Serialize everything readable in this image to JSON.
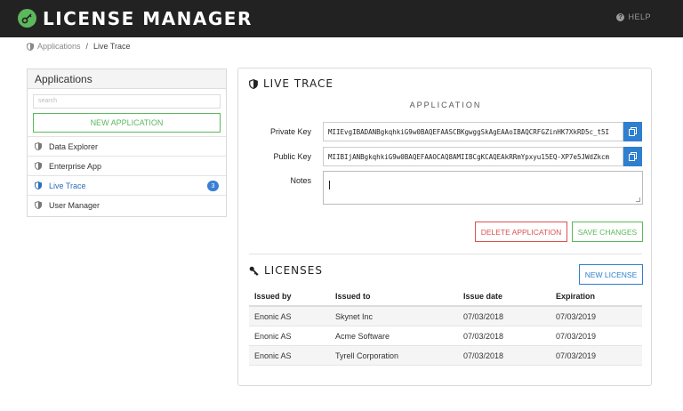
{
  "app": {
    "title": "LICENSE MANAGER",
    "help_label": "HELP",
    "brand_color": "#5cb85c",
    "topbar_color": "#222222"
  },
  "breadcrumb": {
    "root": "Applications",
    "separator": "/",
    "current": "Live Trace"
  },
  "sidebar": {
    "title": "Applications",
    "search_placeholder": "search",
    "new_button": "NEW APPLICATION",
    "items": [
      {
        "label": "Data Explorer",
        "icon": "shield-icon"
      },
      {
        "label": "Enterprise App",
        "icon": "shield-icon"
      },
      {
        "label": "Live Trace",
        "icon": "shield-icon",
        "active": true,
        "badge": "3"
      },
      {
        "label": "User Manager",
        "icon": "shield-icon"
      }
    ]
  },
  "detail": {
    "title": "LIVE TRACE",
    "subheading": "APPLICATION",
    "private_key_label": "Private Key",
    "private_key_value": "MIIEvgIBADANBgkqhkiG9w0BAQEFAASCBKgwggSkAgEAAoIBAQCRFGZinHK7XkRD5c_t5I",
    "public_key_label": "Public Key",
    "public_key_value": "MIIBIjANBgkqhkiG9w0BAQEFAAOCAQ8AMIIBCgKCAQEAkRRmYpxyu15EQ-XP7e5JWdZkcm",
    "notes_label": "Notes",
    "notes_value": "",
    "delete_button": "DELETE APPLICATION",
    "save_button": "SAVE CHANGES"
  },
  "licenses": {
    "title": "LICENSES",
    "new_button": "NEW LICENSE",
    "columns": [
      "Issued by",
      "Issued to",
      "Issue date",
      "Expiration"
    ],
    "rows": [
      [
        "Enonic AS",
        "Skynet Inc",
        "07/03/2018",
        "07/03/2019"
      ],
      [
        "Enonic AS",
        "Acme Software",
        "07/03/2018",
        "07/03/2019"
      ],
      [
        "Enonic AS",
        "Tyrell Corporation",
        "07/03/2018",
        "07/03/2019"
      ]
    ]
  }
}
